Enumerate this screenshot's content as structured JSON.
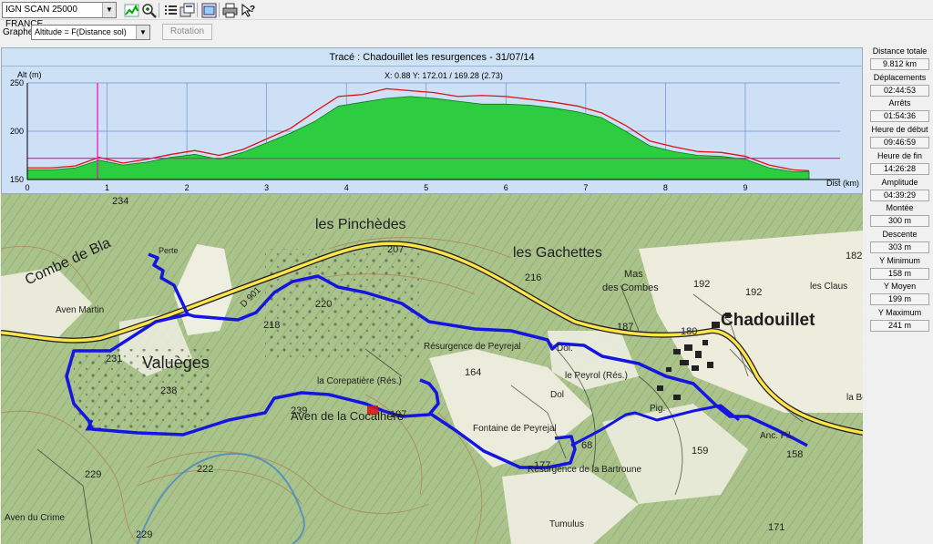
{
  "toolbar": {
    "map_layer": "IGN SCAN 25000 FRANCE",
    "icons": [
      "profile-graph-icon",
      "zoom-icon",
      "list-icon",
      "export-icon",
      "map-window-icon",
      "print-icon",
      "help-icon"
    ]
  },
  "graph_controls": {
    "label": "Graphe",
    "mode": "Altitude = F(Distance sol)",
    "rotation_button": "Rotation"
  },
  "profile": {
    "title": "Tracé : Chadouillet les resurgences - 31/07/14",
    "cursor_readout": "X: 0.88 Y: 172.01 / 169.28 (2.73)",
    "y_axis_label": "Alt (m)",
    "x_axis_label": "Dist (km)",
    "y_ticks": [
      "250",
      "200",
      "150"
    ],
    "x_ticks": [
      "0",
      "1",
      "2",
      "3",
      "4",
      "5",
      "6",
      "7",
      "8",
      "9"
    ],
    "colors": {
      "ground": "#2ecc40",
      "track": "#e01010",
      "cursor": "#ff00c8",
      "background": "#cde0f5"
    }
  },
  "chart_data": {
    "type": "area",
    "xlabel": "Dist (km)",
    "ylabel": "Alt (m)",
    "xlim": [
      0,
      9.812
    ],
    "ylim": [
      150,
      250
    ],
    "cursor_x": 0.88,
    "reference_altitude": 172,
    "series": [
      {
        "x": [
          0,
          0.3,
          0.6,
          0.9,
          1.2,
          1.5,
          1.8,
          2.1,
          2.4,
          2.7,
          3.0,
          3.3,
          3.6,
          3.9,
          4.2,
          4.5,
          4.8,
          5.1,
          5.4,
          5.7,
          6.0,
          6.3,
          6.6,
          6.9,
          7.2,
          7.5,
          7.8,
          8.1,
          8.4,
          8.7,
          9.0,
          9.3,
          9.6,
          9.8
        ],
        "values": [
          160,
          160,
          162,
          170,
          165,
          168,
          173,
          176,
          171,
          178,
          188,
          198,
          210,
          226,
          230,
          234,
          236,
          234,
          231,
          228,
          228,
          227,
          224,
          220,
          214,
          200,
          185,
          179,
          175,
          174,
          171,
          162,
          158,
          158
        ]
      },
      {
        "x": [
          0,
          0.3,
          0.6,
          0.9,
          1.2,
          1.5,
          1.8,
          2.1,
          2.4,
          2.7,
          3.0,
          3.3,
          3.6,
          3.9,
          4.2,
          4.5,
          4.8,
          5.1,
          5.4,
          5.7,
          6.0,
          6.3,
          6.6,
          6.9,
          7.2,
          7.5,
          7.8,
          8.1,
          8.4,
          8.7,
          9.0,
          9.3,
          9.6,
          9.8
        ],
        "values": [
          162,
          162,
          164,
          173,
          167,
          171,
          176,
          180,
          175,
          181,
          192,
          203,
          220,
          236,
          238,
          244,
          242,
          240,
          236,
          237,
          236,
          233,
          230,
          226,
          219,
          206,
          190,
          184,
          179,
          178,
          174,
          165,
          160,
          159
        ]
      }
    ]
  },
  "map": {
    "labels": {
      "pinchedes": "les Pinchèdes",
      "gachettes": "les Gachettes",
      "chadouillet": "Chadouillet",
      "valueges": "Valuèges",
      "mas": "Mas",
      "des_combes": "des Combes",
      "combe_de_blanc": "Combe de Bla",
      "aven_martin": "Aven Martin",
      "perte": "Perte",
      "resurgence_peyrejal": "Résurgence de Peyrejal",
      "corepatiere": "la Corepatière (Rés.)",
      "aven_cocalhere": "Aven de la Cocalhère",
      "fontaine": "Fontaine de Peyrejal",
      "peyrol": "le Peyrol (Rés.)",
      "resurgence_bartroune": "Résurgence de la Bartroune",
      "tumulus": "Tumulus",
      "aven_du_crime": "Aven du Crime",
      "les_claus": "les Claus",
      "la_bou": "la Bou",
      "dol1": "Dol.",
      "dol2": "Dol",
      "pig": "Pig.",
      "anc_fil": "Anc. Fil.",
      "n207": "207",
      "n216": "216",
      "n218": "218",
      "n220": "220",
      "n187": "187",
      "n180": "180",
      "n192a": "192",
      "n192b": "192",
      "n231": "231",
      "n238": "238",
      "n239": "239",
      "n164": "164",
      "n197": "197",
      "n168": "68",
      "n159": "159",
      "n177": "177",
      "n158": "158",
      "n234": "234",
      "n229a": "229",
      "n229b": "229",
      "n222": "222",
      "n182": "182",
      "n171": "171",
      "d901": "D 901"
    }
  },
  "stats": [
    {
      "label": "Distance totale",
      "value": "9.812 km"
    },
    {
      "label": "Déplacements",
      "value": "02:44:53"
    },
    {
      "label": "Arrêts",
      "value": "01:54:36"
    },
    {
      "label": "Heure de début",
      "value": "09:46:59"
    },
    {
      "label": "Heure de fin",
      "value": "14:26:28"
    },
    {
      "label": "Amplitude",
      "value": "04:39:29"
    },
    {
      "label": "Montée",
      "value": "300 m"
    },
    {
      "label": "Descente",
      "value": "303 m"
    },
    {
      "label": "Y Minimum",
      "value": "158 m"
    },
    {
      "label": "Y Moyen",
      "value": "199 m"
    },
    {
      "label": "Y Maximum",
      "value": "241 m"
    }
  ]
}
